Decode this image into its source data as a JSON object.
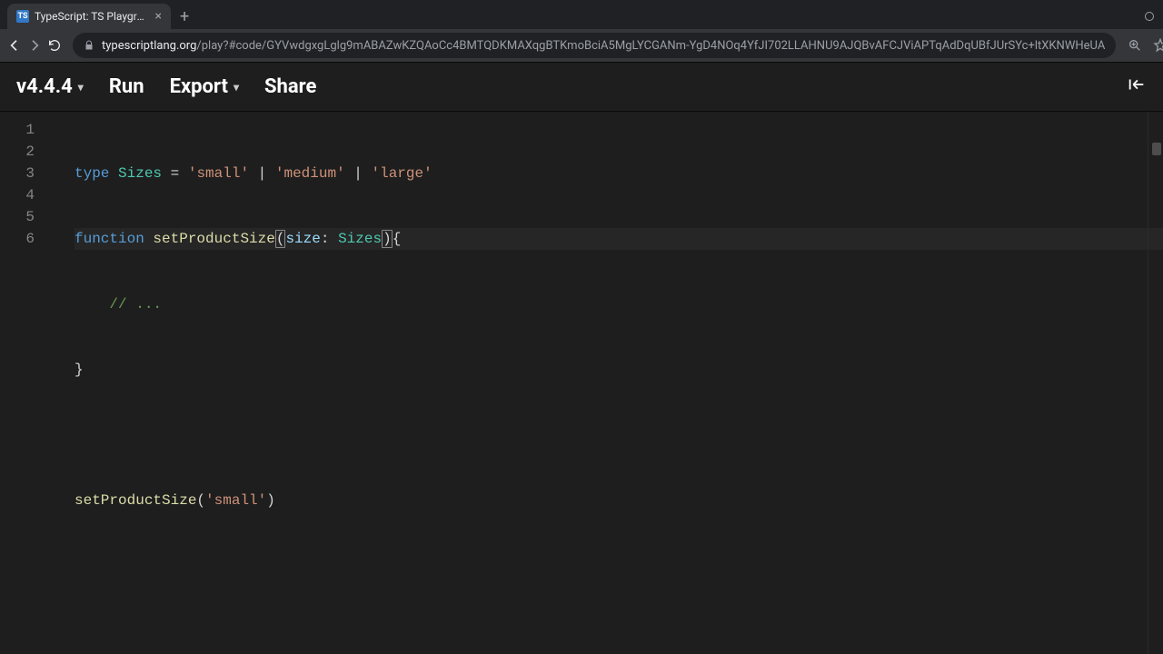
{
  "browser": {
    "tab": {
      "favicon_text": "TS",
      "title": "TypeScript: TS Playground - A"
    },
    "url_domain": "typescriptlang.org",
    "url_path": "/play?#code/GYVwdgxgLglg9mABAZwKZQAoCc4BMTQDKMAXqgBTKmoBciA5MgLYCGANm-YgD4NOq4YfJI702LLAHNU9AJQBvAFCJViAPTqAdDqUBfJUrSYc+ltXKNWHeUA"
  },
  "menubar": {
    "version": "v4.4.4",
    "run": "Run",
    "export": "Export",
    "share": "Share"
  },
  "editor": {
    "line_numbers": [
      "1",
      "2",
      "3",
      "4",
      "5",
      "6"
    ],
    "lines": [
      {
        "raw": "type Sizes = 'small' | 'medium' | 'large'"
      },
      {
        "raw": "function setProductSize(size: Sizes){"
      },
      {
        "raw": "    // ..."
      },
      {
        "raw": "}"
      },
      {
        "raw": ""
      },
      {
        "raw": "setProductSize('small')"
      }
    ],
    "tokens": {
      "l1": {
        "kw": "type",
        "type": "Sizes",
        "eq": " = ",
        "s1": "'small'",
        "p1": " | ",
        "s2": "'medium'",
        "p2": " | ",
        "s3": "'large'"
      },
      "l2": {
        "kw": "function",
        "sp": " ",
        "fn": "setProductSize",
        "lp": "(",
        "param": "size",
        "colon": ": ",
        "ptype": "Sizes",
        "rp": ")",
        "brace": "{"
      },
      "l3": {
        "indent": "    ",
        "comment": "// ..."
      },
      "l4": {
        "brace": "}"
      },
      "l6": {
        "fn": "setProductSize",
        "lp": "(",
        "str": "'small'",
        "rp": ")"
      }
    }
  }
}
